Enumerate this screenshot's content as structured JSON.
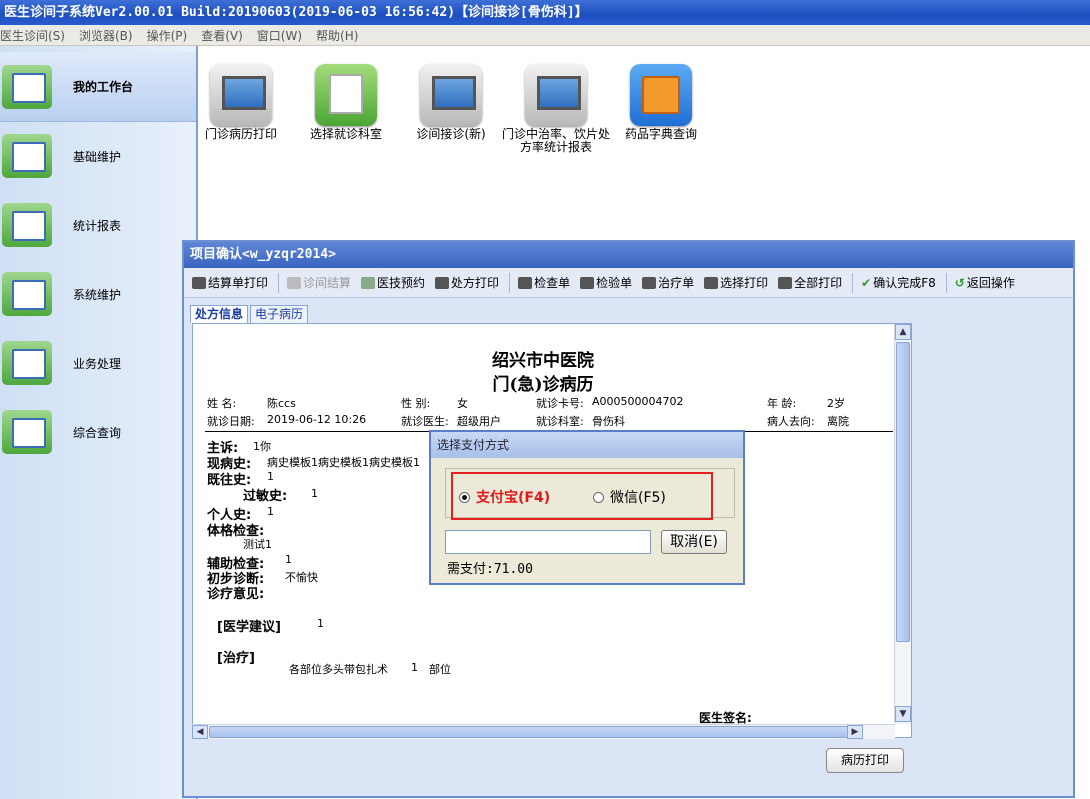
{
  "window": {
    "title": "医生诊间子系统Ver2.00.01 Build:20190603(2019-06-03 16:56:42)【诊间接诊[骨伤科]】"
  },
  "menu": [
    {
      "label": "医生诊间(S)"
    },
    {
      "label": "浏览器(B)"
    },
    {
      "label": "操作(P)"
    },
    {
      "label": "查看(V)"
    },
    {
      "label": "窗口(W)"
    },
    {
      "label": "帮助(H)"
    }
  ],
  "sidebar": {
    "items": [
      {
        "label": "我的工作台",
        "icon": "workstation-icon",
        "active": true
      },
      {
        "label": "基础维护",
        "icon": "maintenance-icon"
      },
      {
        "label": "统计报表",
        "icon": "report-icon"
      },
      {
        "label": "系统维护",
        "icon": "system-icon"
      },
      {
        "label": "业务处理",
        "icon": "business-icon"
      },
      {
        "label": "综合查询",
        "icon": "query-icon"
      }
    ]
  },
  "desktop": {
    "icons": [
      {
        "label": "门诊病历打印",
        "icon": "monitor-icon"
      },
      {
        "label": "选择就诊科室",
        "icon": "department-icon"
      },
      {
        "label": "诊间接诊(新)",
        "icon": "monitor-icon"
      },
      {
        "label": "门诊中治率、饮片处方率统计报表",
        "icon": "monitor-icon"
      },
      {
        "label": "药品字典查询",
        "icon": "dictionary-icon"
      }
    ]
  },
  "dialog": {
    "title": "项目确认<w_yzqr2014>",
    "toolbar": [
      {
        "label": "结算单打印",
        "enabled": true
      },
      {
        "label": "诊间结算",
        "enabled": false
      },
      {
        "label": "医技预约",
        "enabled": true
      },
      {
        "label": "处方打印",
        "enabled": true
      },
      {
        "label": "检查单",
        "enabled": true
      },
      {
        "label": "检验单",
        "enabled": true
      },
      {
        "label": "治疗单",
        "enabled": true
      },
      {
        "label": "选择打印",
        "enabled": true
      },
      {
        "label": "全部打印",
        "enabled": true
      },
      {
        "label": "确认完成F8",
        "enabled": true
      },
      {
        "label": "返回操作",
        "enabled": true
      }
    ],
    "tabs": [
      {
        "label": "处方信息",
        "active": true
      },
      {
        "label": "电子病历"
      }
    ],
    "print_button": "病历打印"
  },
  "record": {
    "hospital": "绍兴市中医院",
    "doc_title": "门(急)诊病历",
    "name_label": "姓 名:",
    "name": "陈ccs",
    "gender_label": "性 别:",
    "gender": "女",
    "card_label": "就诊卡号:",
    "card": "A000500004702",
    "age_label": "年 龄:",
    "age": "2岁",
    "date_label": "就诊日期:",
    "date": "2019-06-12 10:26",
    "doctor_label": "就诊医生:",
    "doctor": "超级用户",
    "dept_label": "就诊科室:",
    "dept": "骨伤科",
    "dest_label": "病人去向:",
    "dest": "离院",
    "complaint_label": "主诉:",
    "complaint": "1你",
    "present_label": "现病史:",
    "present": "病史模板1病史模板1病史模板1",
    "past_label": "既往史:",
    "past": "1",
    "allergy_label": "过敏史:",
    "allergy": "1",
    "personal_label": "个人史:",
    "personal": "1",
    "exam_label": "体格检查:",
    "exam": "测试1",
    "aux_label": "辅助检查:",
    "aux": "1",
    "diag_label": "初步诊断:",
    "diag": "不愉快",
    "opinion_label": "诊疗意见:",
    "advice_label": "[医学建议]",
    "advice": "1",
    "treat_label": "[治疗]",
    "treat_item": "各部位多头带包扎术",
    "treat_qty": "1",
    "treat_unit": "部位",
    "sign_label": "医生签名:"
  },
  "payment": {
    "title": "选择支付方式",
    "options": [
      {
        "label": "支付宝(F4)",
        "selected": true
      },
      {
        "label": "微信(F5)",
        "selected": false
      }
    ],
    "input_value": "",
    "cancel": "取消(E)",
    "amount": "需支付:71.00",
    "highlight_color": "#e52020"
  }
}
